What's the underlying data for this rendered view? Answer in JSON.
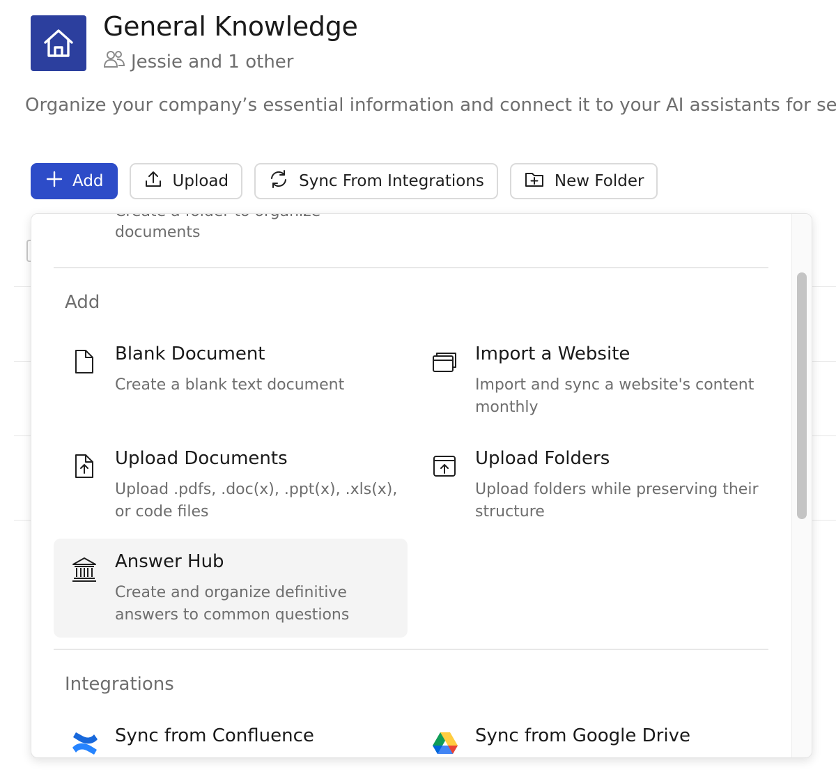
{
  "header": {
    "title": "General Knowledge",
    "members": "Jessie and 1 other",
    "description": "Organize your company’s essential information and connect it to your AI assistants for sea",
    "icon": "house-icon",
    "accent": "#2c3f9e"
  },
  "toolbar": {
    "add_label": "Add",
    "upload_label": "Upload",
    "sync_label": "Sync From Integrations",
    "new_folder_label": "New Folder",
    "primary_color": "#2d4cc8"
  },
  "dropdown": {
    "partial_item": {
      "desc_line1": "Create a folder to organize",
      "desc_line2": "documents"
    },
    "add_section": {
      "label": "Add",
      "items": [
        {
          "title": "Blank Document",
          "desc": "Create a blank text document",
          "icon": "blank-document-icon"
        },
        {
          "title": "Import a Website",
          "desc": "Import and sync a website's content monthly",
          "icon": "browser-windows-icon"
        },
        {
          "title": "Upload Documents",
          "desc": "Upload .pdfs, .doc(x), .ppt(x), .xls(x), or code files",
          "icon": "file-upload-icon"
        },
        {
          "title": "Upload Folders",
          "desc": "Upload folders while preserving their structure",
          "icon": "folder-upload-icon"
        },
        {
          "title": "Answer Hub",
          "desc": "Create and organize definitive answers to common questions",
          "icon": "bank-building-icon"
        }
      ]
    },
    "integrations_section": {
      "label": "Integrations",
      "items": [
        {
          "title": "Sync from Confluence",
          "icon": "confluence-logo-icon"
        },
        {
          "title": "Sync from Google Drive",
          "icon": "google-drive-logo-icon"
        }
      ]
    }
  }
}
